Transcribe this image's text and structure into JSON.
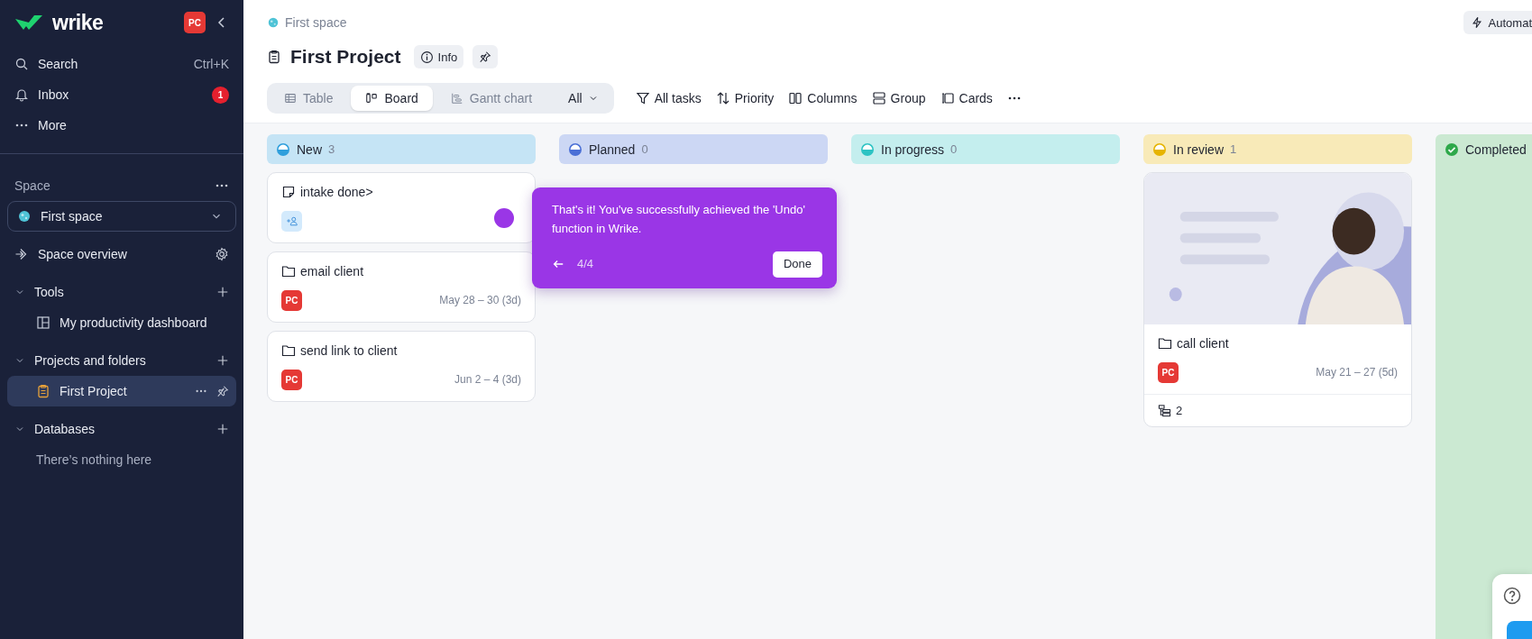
{
  "sidebar": {
    "logo": "wrike",
    "avatar": "PC",
    "nav": [
      {
        "kind": "search",
        "label": "Search",
        "shortcut": "Ctrl+K"
      },
      {
        "kind": "inbox",
        "label": "Inbox",
        "badge": "1"
      },
      {
        "kind": "more",
        "label": "More"
      }
    ],
    "space_label": "Space",
    "space_select": "First space",
    "space_overview": "Space overview",
    "sections": [
      {
        "title": "Tools",
        "expanded": true,
        "items": [
          {
            "kind": "dashboard",
            "label": "My productivity dashboard",
            "selected": false
          }
        ]
      },
      {
        "title": "Projects and folders",
        "expanded": true,
        "items": [
          {
            "kind": "project",
            "label": "First Project",
            "selected": true
          }
        ]
      },
      {
        "title": "Databases",
        "expanded": true,
        "empty_text": "There’s nothing here"
      }
    ]
  },
  "header": {
    "breadcrumb": "First space",
    "title": "First Project",
    "info_button": "Info",
    "automations_button": "Automat",
    "views": [
      {
        "kind": "table",
        "label": "Table",
        "selected": false
      },
      {
        "kind": "board",
        "label": "Board",
        "selected": true
      },
      {
        "kind": "gantt",
        "label": "Gantt chart",
        "selected": false
      }
    ],
    "view_filter": "All",
    "toolbar": [
      {
        "kind": "filter",
        "label": "All tasks"
      },
      {
        "kind": "sort",
        "label": "Priority"
      },
      {
        "kind": "columns",
        "label": "Columns"
      },
      {
        "kind": "group",
        "label": "Group"
      },
      {
        "kind": "cards",
        "label": "Cards"
      }
    ]
  },
  "columns": [
    {
      "name": "New",
      "count": "3",
      "kind": "active",
      "color": "#2f9fdc",
      "cards": [
        {
          "kind": "task",
          "title": "intake done>",
          "add_assignee": true
        },
        {
          "kind": "folder",
          "title": "email client",
          "assignee": "PC",
          "dates": "May 28 – 30 (3d)"
        },
        {
          "kind": "folder",
          "title": "send link to client",
          "assignee": "PC",
          "dates": "Jun 2 – 4 (3d)"
        }
      ]
    },
    {
      "name": "Planned",
      "count": "0",
      "kind": "active",
      "color": "#4a6fd6"
    },
    {
      "name": "In progress",
      "count": "0",
      "kind": "active",
      "color": "#2cc3c3"
    },
    {
      "name": "In review",
      "count": "1",
      "kind": "active",
      "color": "#e6b400",
      "cards": [
        {
          "kind": "folder",
          "title": "call client",
          "assignee": "PC",
          "dates": "May 21 – 27 (5d)",
          "subtasks": "2"
        }
      ]
    },
    {
      "name": "Completed",
      "kind": "completed",
      "color": "#2ea84a"
    }
  ],
  "tour": {
    "text": "That's it! You've successfully achieved the 'Undo' function in Wrike.",
    "step": "4/4",
    "button": "Done"
  }
}
